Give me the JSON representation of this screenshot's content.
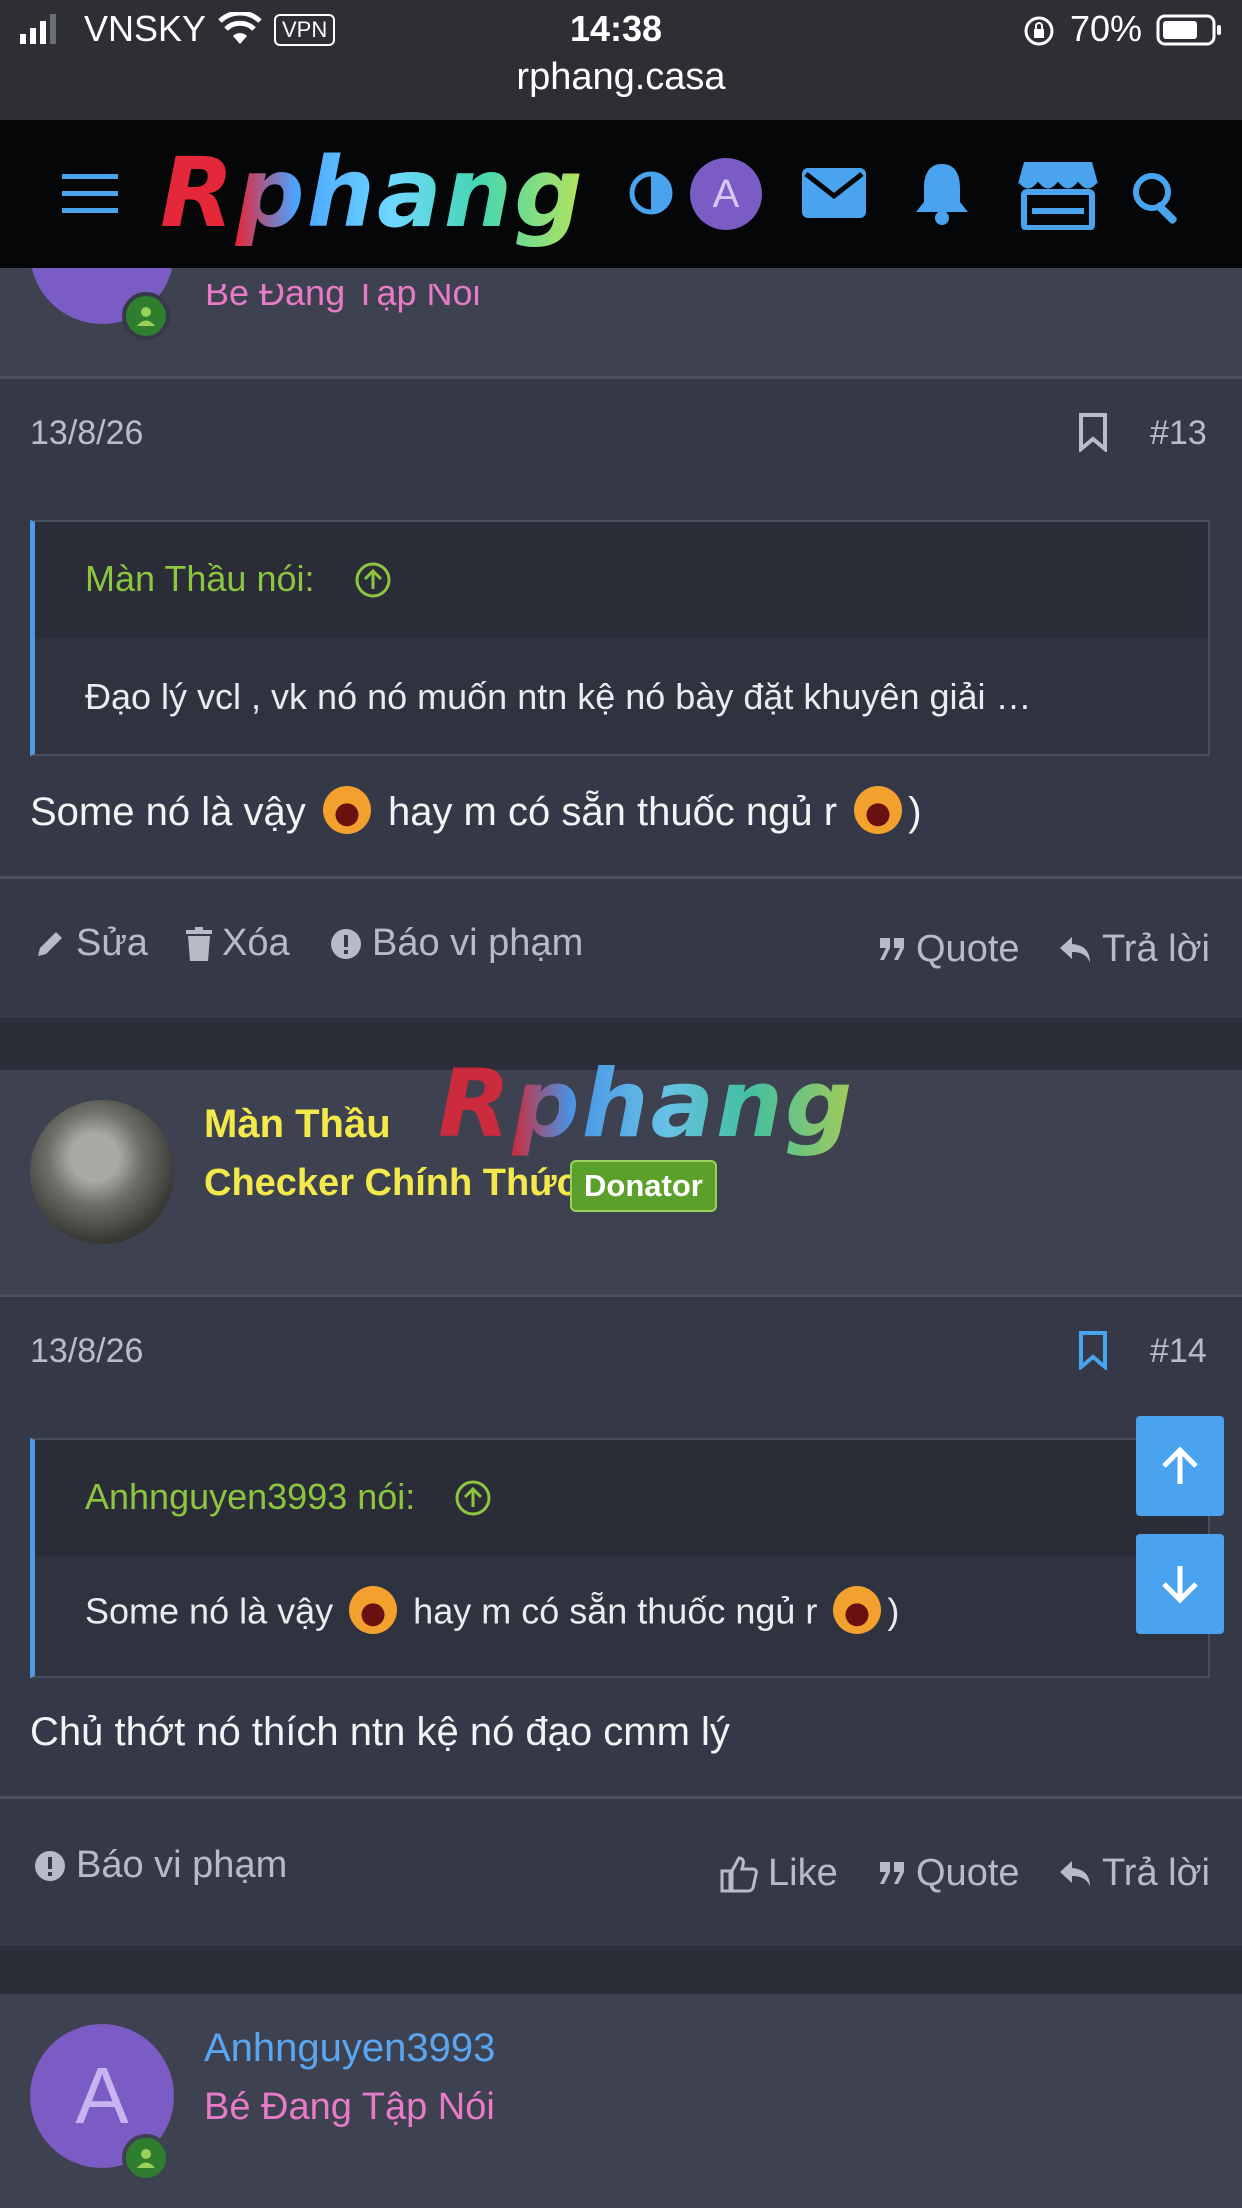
{
  "status_bar": {
    "carrier": "VNSKY",
    "vpn": "VPN",
    "time": "14:38",
    "battery": "70%",
    "url": "rphang.casa"
  },
  "nav": {
    "logo": "Rphang",
    "user_avatar_letter": "A",
    "icons": [
      "menu-icon",
      "contrast-icon",
      "mail-icon",
      "bell-icon",
      "store-icon",
      "search-icon"
    ]
  },
  "posts": [
    {
      "top_user_title": "Bé Đang Tập Nói",
      "date": "13/8/26",
      "number": "#13",
      "quote_author": "Màn Thầu nói:",
      "quote_text": "Đạo lý vcl , vk nó nó muốn ntn kệ nó bày đặt khuyên giải …",
      "text_part1": "Some nó là vậy",
      "text_part2": "hay m có sẵn thuốc ngủ r",
      "text_part3": ")",
      "actions": {
        "edit": "Sửa",
        "delete": "Xóa",
        "report": "Báo vi phạm",
        "quote": "Quote",
        "reply": "Trả lời"
      }
    },
    {
      "username": "Màn Thầu",
      "user_title": "Checker Chính Thức",
      "badge": "Donator",
      "watermark": "Rphang",
      "date": "13/8/26",
      "number": "#14",
      "quote_author": "Anhnguyen3993 nói:",
      "quote_part1": "Some nó là vậy",
      "quote_part2": "hay m có sẵn thuốc ngủ r",
      "quote_part3": ")",
      "text": "Chủ thớt nó thích ntn kệ nó đạo cmm lý",
      "actions": {
        "report": "Báo vi phạm",
        "like": "Like",
        "quote": "Quote",
        "reply": "Trả lời"
      }
    },
    {
      "avatar_letter": "A",
      "username": "Anhnguyen3993",
      "user_title": "Bé Đang Tập Nói"
    }
  ],
  "colors": {
    "accent_blue": "#4aa3ee",
    "quote_green": "#8cc63f",
    "username_yellow": "#f4e94a",
    "username_blue": "#5aa6f0",
    "title_pink": "#e87bc8",
    "donator_green": "#5ca02c"
  }
}
